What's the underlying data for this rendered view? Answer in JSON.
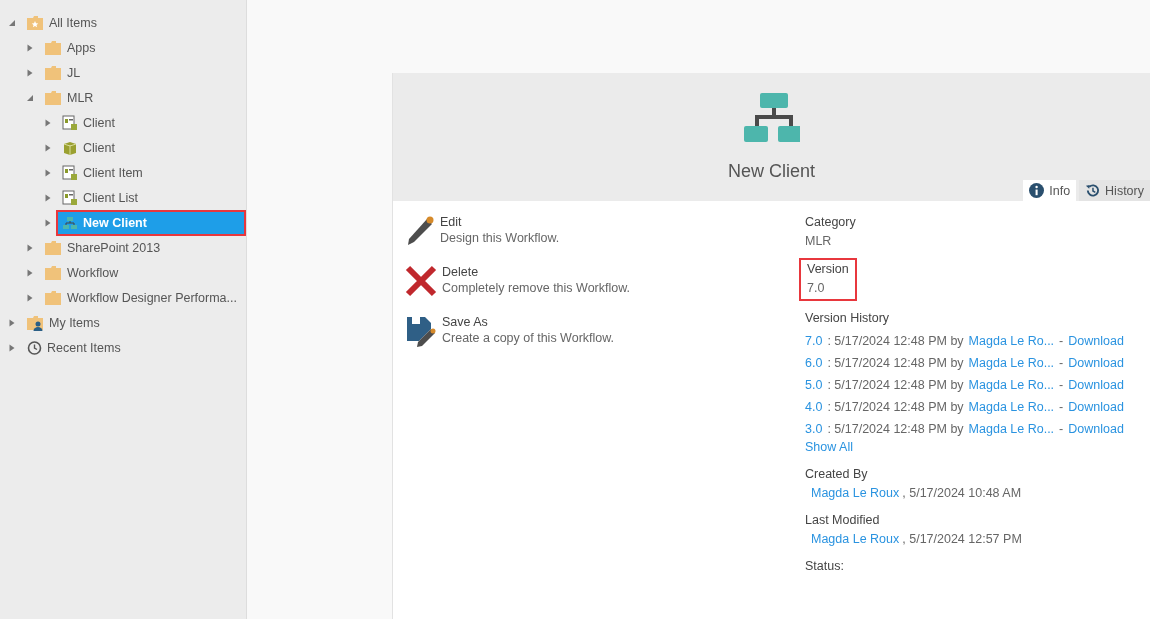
{
  "tree": [
    {
      "label": "All Items",
      "kind": "star-folder",
      "expanded": true,
      "selected": false,
      "highlighted": false,
      "children": [
        {
          "label": "Apps",
          "kind": "folder",
          "expanded": false,
          "selected": false,
          "highlighted": false
        },
        {
          "label": "JL",
          "kind": "folder",
          "expanded": false,
          "selected": false,
          "highlighted": false
        },
        {
          "label": "MLR",
          "kind": "folder",
          "expanded": true,
          "selected": false,
          "highlighted": false,
          "children": [
            {
              "label": "Client",
              "kind": "smartobject",
              "expanded": false,
              "selected": false,
              "highlighted": false
            },
            {
              "label": "Client",
              "kind": "package",
              "expanded": false,
              "selected": false,
              "highlighted": false
            },
            {
              "label": "Client Item",
              "kind": "form",
              "expanded": false,
              "selected": false,
              "highlighted": false
            },
            {
              "label": "Client List",
              "kind": "form",
              "expanded": false,
              "selected": false,
              "highlighted": false
            },
            {
              "label": "New Client",
              "kind": "workflow",
              "expanded": false,
              "selected": true,
              "highlighted": true
            }
          ]
        },
        {
          "label": "SharePoint 2013",
          "kind": "folder",
          "expanded": false,
          "selected": false,
          "highlighted": false
        },
        {
          "label": "Workflow",
          "kind": "folder",
          "expanded": false,
          "selected": false,
          "highlighted": false
        },
        {
          "label": "Workflow Designer Performa...",
          "kind": "folder",
          "expanded": false,
          "selected": false,
          "highlighted": false
        }
      ]
    },
    {
      "label": "My Items",
      "kind": "user-folder",
      "expanded": false,
      "selected": false,
      "highlighted": false
    },
    {
      "label": "Recent Items",
      "kind": "clock",
      "expanded": false,
      "selected": false,
      "highlighted": false
    }
  ],
  "header": {
    "title": "New Client"
  },
  "tabs": [
    {
      "label": "Info",
      "kind": "info",
      "selected": true
    },
    {
      "label": "History",
      "kind": "history",
      "selected": false
    }
  ],
  "actions": [
    {
      "kind": "edit",
      "title": "Edit",
      "description": "Design this Workflow."
    },
    {
      "kind": "delete",
      "title": "Delete",
      "description": "Completely remove this Workflow."
    },
    {
      "kind": "save-as",
      "title": "Save As",
      "description": "Create a copy of this Workflow."
    }
  ],
  "info": {
    "category": {
      "label": "Category",
      "value": "MLR"
    },
    "version": {
      "label": "Version",
      "value": "7.0",
      "highlighted": true
    },
    "version_history": {
      "label": "Version History",
      "rows": [
        {
          "version": "7.0",
          "detail": ": 5/17/2024 12:48 PM by",
          "user": "Magda Le Ro...",
          "dash": "-",
          "download": "Download"
        },
        {
          "version": "6.0",
          "detail": ": 5/17/2024 12:48 PM by",
          "user": "Magda Le Ro...",
          "dash": "-",
          "download": "Download"
        },
        {
          "version": "5.0",
          "detail": ": 5/17/2024 12:48 PM by",
          "user": "Magda Le Ro...",
          "dash": "-",
          "download": "Download"
        },
        {
          "version": "4.0",
          "detail": ": 5/17/2024 12:48 PM by",
          "user": "Magda Le Ro...",
          "dash": "-",
          "download": "Download"
        },
        {
          "version": "3.0",
          "detail": ": 5/17/2024 12:48 PM by",
          "user": "Magda Le Ro...",
          "dash": "-",
          "download": "Download"
        }
      ],
      "show_all": "Show All"
    },
    "created_by": {
      "label": "Created By",
      "user": "Magda Le Roux",
      "date": ", 5/17/2024 10:48 AM"
    },
    "last_modified": {
      "label": "Last Modified",
      "user": "Magda Le Roux",
      "date": ", 5/17/2024 12:57 PM"
    },
    "status": {
      "label": "Status:"
    }
  }
}
